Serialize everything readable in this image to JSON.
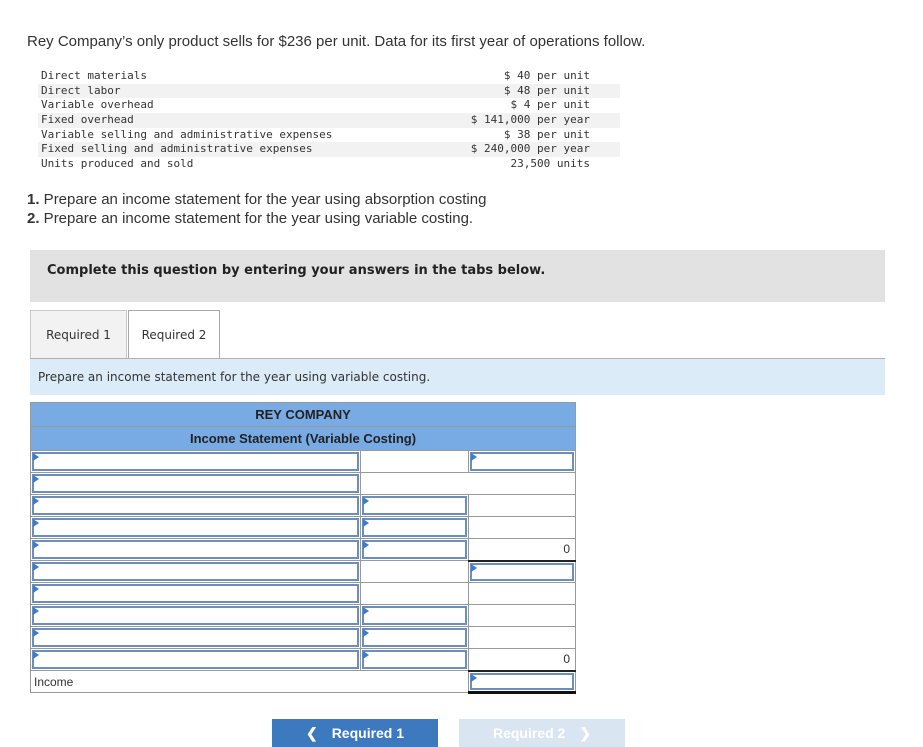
{
  "intro": "Rey Company’s only product sells for $236 per unit. Data for its first year of operations follow.",
  "given_data": [
    {
      "label": "Direct materials",
      "value": "$ 40 per unit"
    },
    {
      "label": "Direct labor",
      "value": "$ 48 per unit"
    },
    {
      "label": "Variable overhead",
      "value": "$ 4 per unit"
    },
    {
      "label": "Fixed overhead",
      "value": "$ 141,000 per year"
    },
    {
      "label": "Variable selling and administrative expenses",
      "value": "$ 38 per unit"
    },
    {
      "label": "Fixed selling and administrative expenses",
      "value": "$ 240,000 per year"
    },
    {
      "label": "Units produced and sold",
      "value": "23,500 units"
    }
  ],
  "requirements": [
    {
      "num": "1.",
      "text": " Prepare an income statement for the year using absorption costing"
    },
    {
      "num": "2.",
      "text": " Prepare an income statement for the year using variable costing."
    }
  ],
  "banner": "Complete this question by entering your answers in the tabs below.",
  "tabs": [
    {
      "label": "Required 1",
      "active": false
    },
    {
      "label": "Required 2",
      "active": true
    }
  ],
  "instruction": "Prepare an income statement for the year using variable costing.",
  "statement": {
    "company": "REY COMPANY",
    "title": "Income Statement (Variable Costing)",
    "rows": [
      {
        "label": "",
        "amount": "",
        "total": ""
      },
      {
        "label": "",
        "amount": "",
        "total": ""
      },
      {
        "label": "",
        "amount": "",
        "total": ""
      },
      {
        "label": "",
        "amount": "",
        "total": ""
      },
      {
        "label": "",
        "amount": "",
        "total": "0"
      },
      {
        "label": "",
        "amount": "",
        "total": ""
      },
      {
        "label": "",
        "amount": "",
        "total": ""
      },
      {
        "label": "",
        "amount": "",
        "total": ""
      },
      {
        "label": "",
        "amount": "",
        "total": ""
      },
      {
        "label": "",
        "amount": "",
        "total": "0"
      }
    ],
    "income_label": "Income",
    "income_value": ""
  },
  "nav": {
    "prev_label": "Required 1",
    "next_label": "Required 2",
    "prev_icon": "chevron-left-icon",
    "next_icon": "chevron-right-icon"
  }
}
